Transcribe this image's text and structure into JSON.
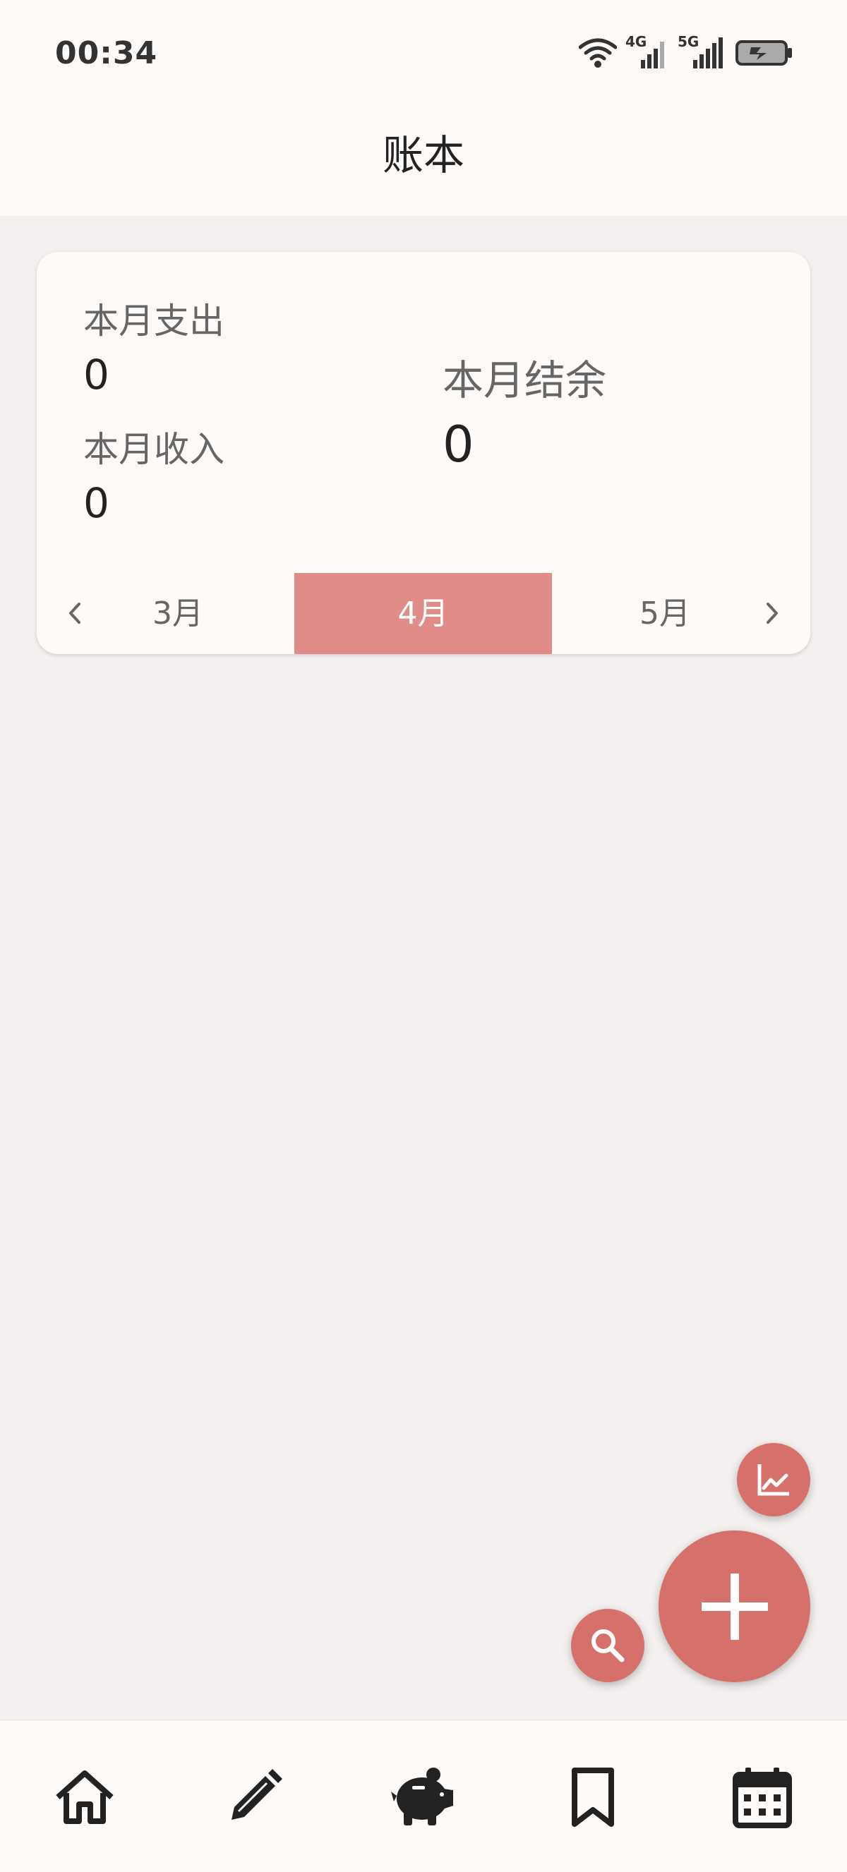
{
  "status_bar": {
    "time": "00:34",
    "network_1": "4G",
    "network_2": "5G",
    "icons": [
      "wifi-icon",
      "signal-4g-icon",
      "signal-5g-icon",
      "battery-charging-icon"
    ]
  },
  "app_bar": {
    "title": "账本"
  },
  "summary": {
    "expense_label": "本月支出",
    "expense_value": "0",
    "income_label": "本月收入",
    "income_value": "0",
    "balance_label": "本月结余",
    "balance_value": "0"
  },
  "month_nav": {
    "prev_label": "3月",
    "current_label": "4月",
    "next_label": "5月",
    "icons": [
      "chevron-left-icon",
      "chevron-right-icon"
    ]
  },
  "fabs": {
    "icons": [
      "chart-icon",
      "add-icon",
      "search-icon"
    ]
  },
  "bottom_nav": {
    "icons": [
      "home-icon",
      "pencil-icon",
      "piggy-bank-icon",
      "bookmark-icon",
      "calendar-icon"
    ]
  },
  "colors": {
    "accent": "#d6706a",
    "accent_light": "#e08d8a",
    "surface": "#fdfaf8",
    "background": "#f4f0f0"
  }
}
